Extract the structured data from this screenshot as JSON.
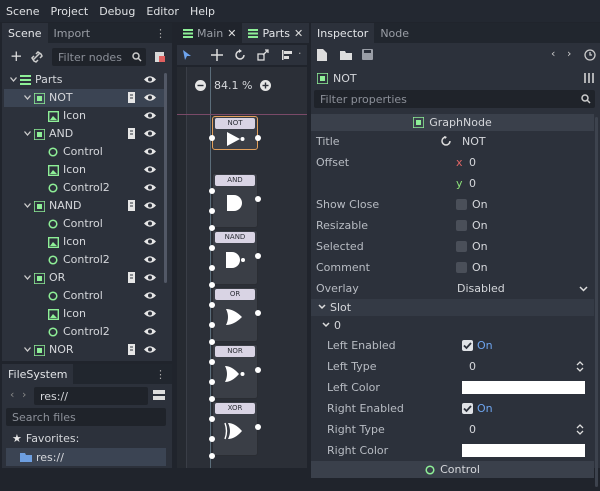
{
  "menu": [
    "Scene",
    "Project",
    "Debug",
    "Editor",
    "Help"
  ],
  "scene_dock": {
    "tabs": [
      "Scene",
      "Import"
    ],
    "filter_placeholder": "Filter nodes",
    "tree": [
      {
        "label": "Parts",
        "icon": "graphedit-icon",
        "depth": 0,
        "expanded": true
      },
      {
        "label": "NOT",
        "icon": "graphnode-icon",
        "depth": 1,
        "selected": true,
        "script": true,
        "expanded": true
      },
      {
        "label": "Icon",
        "icon": "texturerect-icon",
        "depth": 2
      },
      {
        "label": "AND",
        "icon": "graphnode-icon",
        "depth": 1,
        "script": true,
        "expanded": true
      },
      {
        "label": "Control",
        "icon": "control-icon",
        "depth": 2
      },
      {
        "label": "Icon",
        "icon": "texturerect-icon",
        "depth": 2
      },
      {
        "label": "Control2",
        "icon": "control-icon",
        "depth": 2
      },
      {
        "label": "NAND",
        "icon": "graphnode-icon",
        "depth": 1,
        "script": true,
        "expanded": true
      },
      {
        "label": "Control",
        "icon": "control-icon",
        "depth": 2
      },
      {
        "label": "Icon",
        "icon": "texturerect-icon",
        "depth": 2
      },
      {
        "label": "Control2",
        "icon": "control-icon",
        "depth": 2
      },
      {
        "label": "OR",
        "icon": "graphnode-icon",
        "depth": 1,
        "script": true,
        "expanded": true
      },
      {
        "label": "Control",
        "icon": "control-icon",
        "depth": 2
      },
      {
        "label": "Icon",
        "icon": "texturerect-icon",
        "depth": 2
      },
      {
        "label": "Control2",
        "icon": "control-icon",
        "depth": 2
      },
      {
        "label": "NOR",
        "icon": "graphnode-icon",
        "depth": 1,
        "script": true,
        "expanded": true
      }
    ]
  },
  "filesystem": {
    "tab": "FileSystem",
    "path": "res://",
    "search_placeholder": "Search files",
    "favorites": "Favorites:",
    "root": "res://"
  },
  "editor": {
    "tabs": [
      "Main",
      "Parts"
    ],
    "zoom": "84.1 %",
    "nodes": [
      {
        "title": "NOT",
        "gate": "not"
      },
      {
        "title": "AND",
        "gate": "and"
      },
      {
        "title": "NAND",
        "gate": "nand"
      },
      {
        "title": "OR",
        "gate": "or"
      },
      {
        "title": "NOR",
        "gate": "nor"
      },
      {
        "title": "XOR",
        "gate": "xor"
      }
    ]
  },
  "inspector": {
    "tabs": [
      "Inspector",
      "Node"
    ],
    "node_name": "NOT",
    "filter_placeholder": "Filter properties",
    "class_header": "GraphNode",
    "title_label": "Title",
    "title_value": "NOT",
    "offset_label": "Offset",
    "offset_x": "0",
    "offset_y": "0",
    "x_letter": "x",
    "y_letter": "y",
    "bools": [
      {
        "label": "Show Close",
        "value": "On"
      },
      {
        "label": "Resizable",
        "value": "On"
      },
      {
        "label": "Selected",
        "value": "On"
      },
      {
        "label": "Comment",
        "value": "On"
      }
    ],
    "overlay_label": "Overlay",
    "overlay_value": "Disabled",
    "slot_header": "Slot",
    "slot_index": "0",
    "left_enabled_label": "Left Enabled",
    "left_enabled_value": "On",
    "left_type_label": "Left Type",
    "left_type_value": "0",
    "left_color_label": "Left Color",
    "right_enabled_label": "Right Enabled",
    "right_enabled_value": "On",
    "right_type_label": "Right Type",
    "right_type_value": "0",
    "right_color_label": "Right Color",
    "control_header": "Control"
  },
  "colors": {
    "accent": "#699ce8",
    "node_icon": "#8eef97",
    "selection": "#e2a05c",
    "on_text": "#6ea4ee"
  }
}
